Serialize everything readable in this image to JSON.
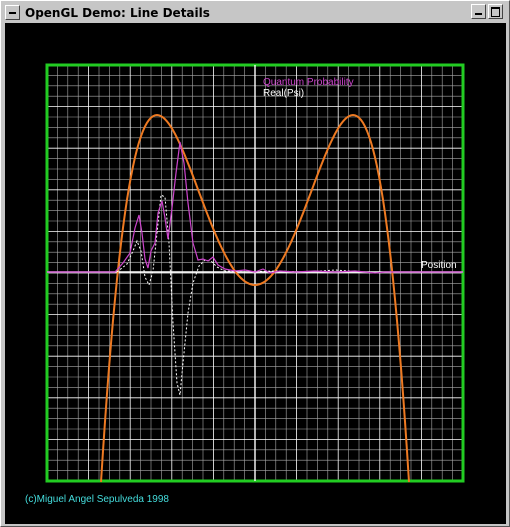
{
  "window": {
    "title": "OpenGL Demo: Line Details"
  },
  "canvas": {
    "legend_probability": "Quantum Probability",
    "legend_real": "Real(Psi)",
    "axis_label": "Position",
    "credit": "(c)Miguel Angel Sepulveda 1998"
  },
  "colors": {
    "grid_major": "#22cc22",
    "grid_minor": "#aaaaaa",
    "axis": "#ffffff",
    "potential": "#ee7a22",
    "probability": "#cc44cc",
    "real_psi": "#ffffff",
    "credit": "#44dddd"
  },
  "icons": {
    "window_menu": "window-menu-icon",
    "minimize": "minimize-icon",
    "maximize": "maximize-icon"
  }
}
